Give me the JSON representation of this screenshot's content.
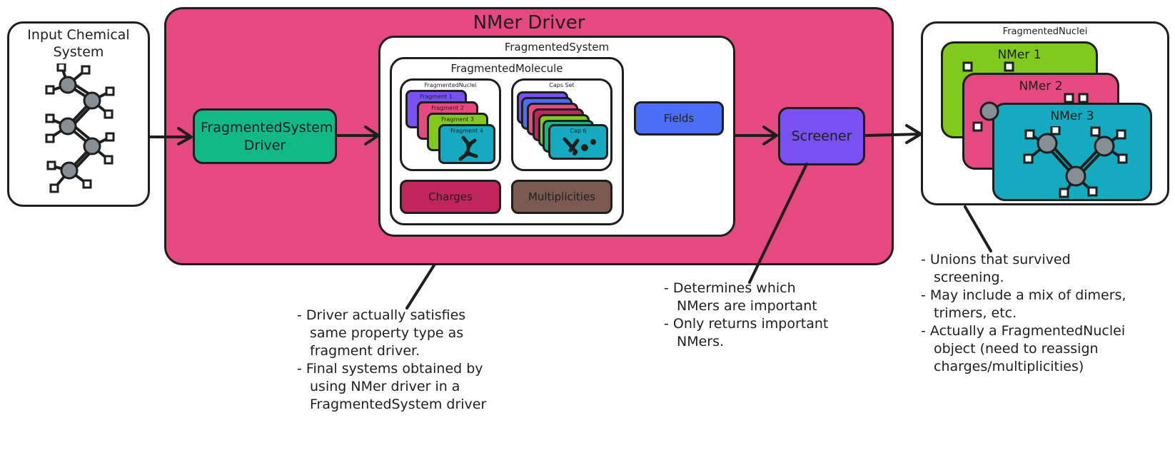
{
  "input_system": {
    "title": "Input Chemical System"
  },
  "nmer_driver": {
    "title": "NMer Driver"
  },
  "fragsys_driver": {
    "label": "FragmentedSystem Driver"
  },
  "fragmented_system": {
    "title": "FragmentedSystem",
    "fragmented_molecule": {
      "title": "FragmentedMolecule",
      "nuclei_stack": {
        "title": "FragmentedNuclei",
        "cards": [
          "Fragment 1",
          "Fragment 2",
          "Fragment 3",
          "Fragment 4"
        ]
      },
      "caps_stack": {
        "title": "Caps Set",
        "cards": [
          "Cap 6"
        ]
      },
      "charges": "Charges",
      "multiplicities": "Multiplicities"
    },
    "fields": "Fields"
  },
  "screener": {
    "label": "Screener"
  },
  "output": {
    "title": "FragmentedNuclei",
    "cards": [
      "NMer 1",
      "NMer 2",
      "NMer 3"
    ]
  },
  "notes": {
    "driver": [
      "Driver actually satisfies same property type as fragment driver.",
      "Final systems obtained by using NMer driver in a FragmentedSystem driver"
    ],
    "screener": [
      "Determines which NMers are important",
      "Only returns important NMers."
    ],
    "output": [
      "Unions that survived screening.",
      "May include a mix of dimers, trimers, etc.",
      "Actually a FragmentedNuclei object (need to reassign charges/multiplicities)"
    ]
  },
  "colors": {
    "nmer_driver": "#e64980",
    "fragsys_driver": "#12b886",
    "screener": "#7950f2",
    "fields": "#4c6ef5",
    "charges": "#c2255c",
    "multiplicities": "#7b5a4f",
    "nmer1": "#82c91e",
    "nmer2": "#e64980",
    "nmer3": "#15aabf"
  }
}
